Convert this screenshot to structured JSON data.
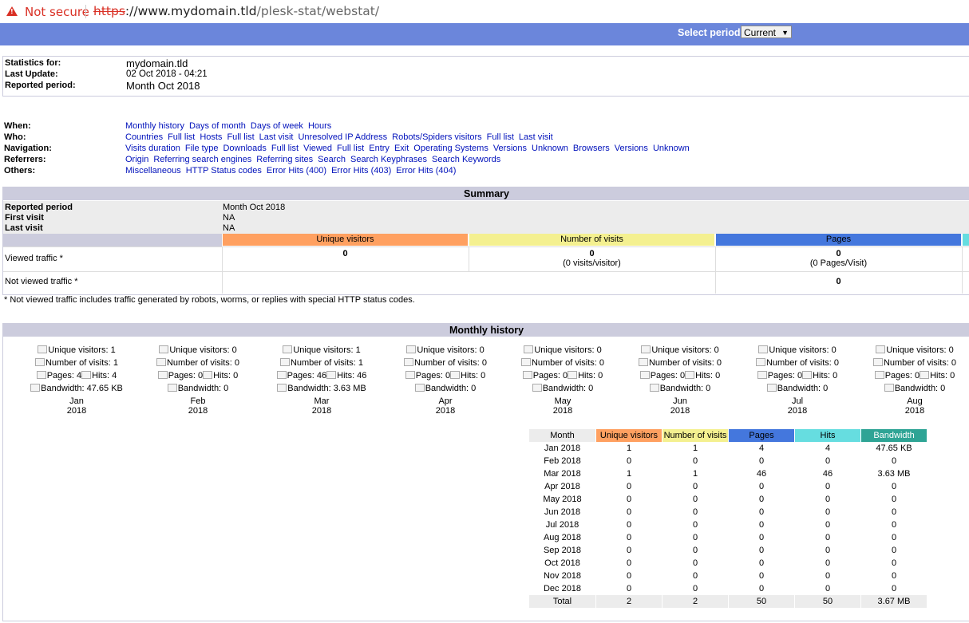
{
  "browser": {
    "security_label": "Not secure",
    "url_scheme": "https",
    "url_host": "://www.mydomain.tld",
    "url_path": "/plesk-stat/webstat/"
  },
  "period": {
    "label": "Select period",
    "selected": "Current"
  },
  "info": {
    "stats_for_label": "Statistics for:",
    "stats_for": "mydomain.tld",
    "last_update_label": "Last Update:",
    "last_update": "02 Oct 2018 - 04:21",
    "reported_period_label": "Reported period:",
    "reported_period": "Month Oct 2018"
  },
  "nav": {
    "when_label": "When:",
    "when": [
      "Monthly history",
      "Days of month",
      "Days of week",
      "Hours"
    ],
    "who_label": "Who:",
    "who": [
      "Countries",
      "Full list",
      "Hosts",
      "Full list",
      "Last visit",
      "Unresolved IP Address",
      "Robots/Spiders visitors",
      "Full list",
      "Last visit"
    ],
    "navigation_label": "Navigation:",
    "navigation": [
      "Visits duration",
      "File type",
      "Downloads",
      "Full list",
      "Viewed",
      "Full list",
      "Entry",
      "Exit",
      "Operating Systems",
      "Versions",
      "Unknown",
      "Browsers",
      "Versions",
      "Unknown"
    ],
    "referrers_label": "Referrers:",
    "referrers": [
      "Origin",
      "Referring search engines",
      "Referring sites",
      "Search",
      "Search Keyphrases",
      "Search Keywords"
    ],
    "others_label": "Others:",
    "others": [
      "Miscellaneous",
      "HTTP Status codes",
      "Error Hits (400)",
      "Error Hits (403)",
      "Error Hits (404)"
    ]
  },
  "summary": {
    "title": "Summary",
    "reported_period_label": "Reported period",
    "reported_period": "Month Oct 2018",
    "first_visit_label": "First visit",
    "first_visit": "NA",
    "last_visit_label": "Last visit",
    "last_visit": "NA",
    "col_unique": "Unique visitors",
    "col_visits": "Number of visits",
    "col_pages": "Pages",
    "viewed_label": "Viewed traffic *",
    "viewed_unique": "0",
    "viewed_visits": "0",
    "viewed_visits_sub": "(0 visits/visitor)",
    "viewed_pages": "0",
    "viewed_pages_sub": "(0 Pages/Visit)",
    "not_viewed_label": "Not viewed traffic *",
    "not_viewed_pages": "0",
    "footnote": "* Not viewed traffic includes traffic generated by robots, worms, or replies with special HTTP status codes."
  },
  "monthly": {
    "title": "Monthly history",
    "graph": [
      {
        "unique": "Unique visitors: 1",
        "visits": "Number of visits: 1",
        "pages": "Pages: 4",
        "hits": "Hits: 4",
        "bw": "Bandwidth: 47.65 KB",
        "month": "Jan",
        "year": "2018"
      },
      {
        "unique": "Unique visitors: 0",
        "visits": "Number of visits: 0",
        "pages": "Pages: 0",
        "hits": "Hits: 0",
        "bw": "Bandwidth: 0",
        "month": "Feb",
        "year": "2018"
      },
      {
        "unique": "Unique visitors: 1",
        "visits": "Number of visits: 1",
        "pages": "Pages: 46",
        "hits": "Hits: 46",
        "bw": "Bandwidth: 3.63 MB",
        "month": "Mar",
        "year": "2018"
      },
      {
        "unique": "Unique visitors: 0",
        "visits": "Number of visits: 0",
        "pages": "Pages: 0",
        "hits": "Hits: 0",
        "bw": "Bandwidth: 0",
        "month": "Apr",
        "year": "2018"
      },
      {
        "unique": "Unique visitors: 0",
        "visits": "Number of visits: 0",
        "pages": "Pages: 0",
        "hits": "Hits: 0",
        "bw": "Bandwidth: 0",
        "month": "May",
        "year": "2018"
      },
      {
        "unique": "Unique visitors: 0",
        "visits": "Number of visits: 0",
        "pages": "Pages: 0",
        "hits": "Hits: 0",
        "bw": "Bandwidth: 0",
        "month": "Jun",
        "year": "2018"
      },
      {
        "unique": "Unique visitors: 0",
        "visits": "Number of visits: 0",
        "pages": "Pages: 0",
        "hits": "Hits: 0",
        "bw": "Bandwidth: 0",
        "month": "Jul",
        "year": "2018"
      },
      {
        "unique": "Unique visitors: 0",
        "visits": "Number of visits: 0",
        "pages": "Pages: 0",
        "hits": "Hits: 0",
        "bw": "Bandwidth: 0",
        "month": "Aug",
        "year": "2018"
      }
    ],
    "table_headers": [
      "Month",
      "Unique visitors",
      "Number of visits",
      "Pages",
      "Hits",
      "Bandwidth"
    ],
    "rows": [
      [
        "Jan 2018",
        "1",
        "1",
        "4",
        "4",
        "47.65 KB"
      ],
      [
        "Feb 2018",
        "0",
        "0",
        "0",
        "0",
        "0"
      ],
      [
        "Mar 2018",
        "1",
        "1",
        "46",
        "46",
        "3.63 MB"
      ],
      [
        "Apr 2018",
        "0",
        "0",
        "0",
        "0",
        "0"
      ],
      [
        "May 2018",
        "0",
        "0",
        "0",
        "0",
        "0"
      ],
      [
        "Jun 2018",
        "0",
        "0",
        "0",
        "0",
        "0"
      ],
      [
        "Jul 2018",
        "0",
        "0",
        "0",
        "0",
        "0"
      ],
      [
        "Aug 2018",
        "0",
        "0",
        "0",
        "0",
        "0"
      ],
      [
        "Sep 2018",
        "0",
        "0",
        "0",
        "0",
        "0"
      ],
      [
        "Oct 2018",
        "0",
        "0",
        "0",
        "0",
        "0"
      ],
      [
        "Nov 2018",
        "0",
        "0",
        "0",
        "0",
        "0"
      ],
      [
        "Dec 2018",
        "0",
        "0",
        "0",
        "0",
        "0"
      ]
    ],
    "total": [
      "Total",
      "2",
      "2",
      "50",
      "50",
      "3.67 MB"
    ]
  },
  "colors": {
    "period_bar": "#6b86db",
    "unique": "#ffa060",
    "visits": "#f4f090",
    "pages": "#4477dd",
    "hits": "#66dde0",
    "bandwidth": "#2ea495",
    "header_bg": "#ccccdd"
  }
}
